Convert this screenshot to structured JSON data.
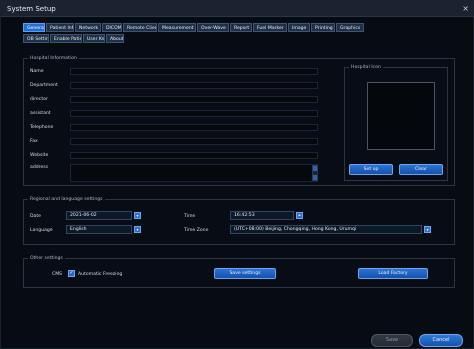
{
  "window": {
    "title": "System Setup",
    "close_glyph": "×"
  },
  "tabs": [
    "General",
    "Patient Info",
    "Network",
    "DICOM",
    "Remote Client",
    "Measurement",
    "Over-Wave",
    "Report",
    "Fuel Marker",
    "Image",
    "Printing",
    "Graphics",
    "OB Settings",
    "Enable Patient",
    "User Key",
    "About"
  ],
  "hospital_info": {
    "title": "Hospital Information",
    "fields": [
      "Name",
      "Department",
      "director",
      "assistant",
      "Telephone",
      "Fax",
      "Website",
      "address"
    ],
    "logo_title": "Hospital Icon",
    "setup_label": "Set up",
    "clear_label": "Clear"
  },
  "regional": {
    "title": "Regional and language settings",
    "date_label": "Date",
    "date_value": "2021-06-02",
    "time_label": "Time",
    "time_value": "16:42:53",
    "language_label": "Language",
    "language_value": "English",
    "timezone_label": "Time Zone",
    "timezone_value": "(UTC+08:00) Beijing, Chongqing, Hong Kong, Urumqi"
  },
  "other": {
    "title": "Other settings",
    "cms_label": "CMS",
    "checkbox_mark": "✓",
    "auto_freeze_label": "Automatic Freezing",
    "save_settings_label": "Save settings",
    "load_factory_label": "Load Factory"
  },
  "footer": {
    "save_label": "Save",
    "cancel_label": "Cancel"
  },
  "icons": {
    "dropdown": "▾",
    "spin": "◂▸"
  }
}
